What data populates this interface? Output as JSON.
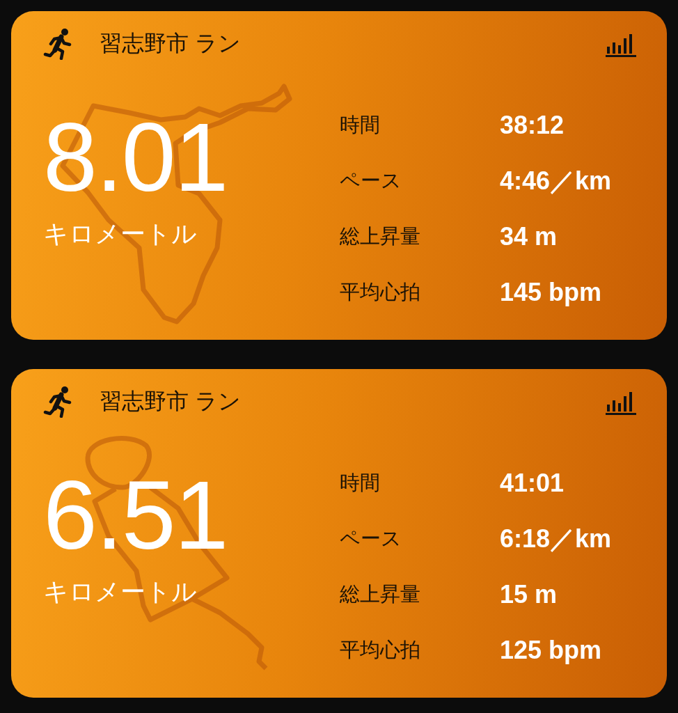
{
  "cards": [
    {
      "title": "習志野市 ラン",
      "distance": "8.01",
      "unit": "キロメートル",
      "stats": [
        {
          "label": "時間",
          "value": "38:12"
        },
        {
          "label": "ペース",
          "value": "4:46／km"
        },
        {
          "label": "総上昇量",
          "value": "34 m"
        },
        {
          "label": "平均心拍",
          "value": "145 bpm"
        }
      ]
    },
    {
      "title": "習志野市 ラン",
      "distance": "6.51",
      "unit": "キロメートル",
      "stats": [
        {
          "label": "時間",
          "value": "41:01"
        },
        {
          "label": "ペース",
          "value": "6:18／km"
        },
        {
          "label": "総上昇量",
          "value": "15 m"
        },
        {
          "label": "平均心拍",
          "value": "125 bpm"
        }
      ]
    }
  ]
}
